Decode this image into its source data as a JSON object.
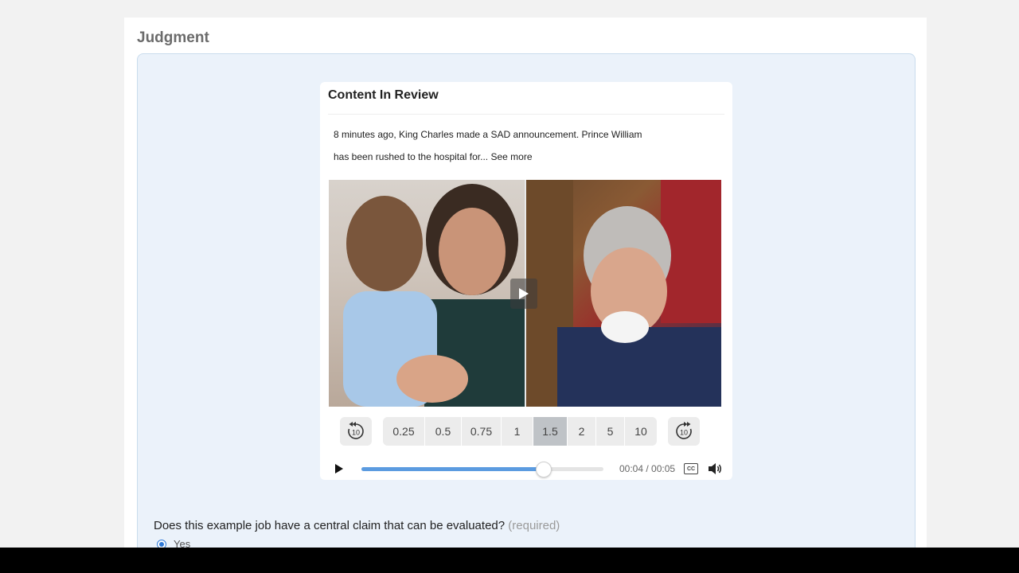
{
  "section": {
    "title": "Judgment"
  },
  "review": {
    "title": "Content In Review",
    "post_line1": "8 minutes ago, King Charles made a SAD announcement. Prince William",
    "post_line2": "has been rushed to the hospital for...",
    "see_more": "See more"
  },
  "player": {
    "skip_back_label": "10",
    "skip_forward_label": "10",
    "speeds": [
      "0.25",
      "0.5",
      "0.75",
      "1",
      "1.5",
      "2",
      "5",
      "10"
    ],
    "active_speed": "1.5",
    "time": "00:04 / 00:05",
    "cc_label": "CC",
    "progress_fraction": 0.75,
    "accent_color": "#5b9be0"
  },
  "question": {
    "text": "Does this example job have a central claim that can be evaluated?",
    "required_label": "(required)",
    "option_label": "Yes"
  },
  "icons": {
    "play": "play-icon",
    "video_play": "video-play-icon",
    "skip_back": "replay-10-icon",
    "skip_forward": "forward-10-icon",
    "cc": "closed-captions-icon",
    "volume": "volume-icon"
  }
}
